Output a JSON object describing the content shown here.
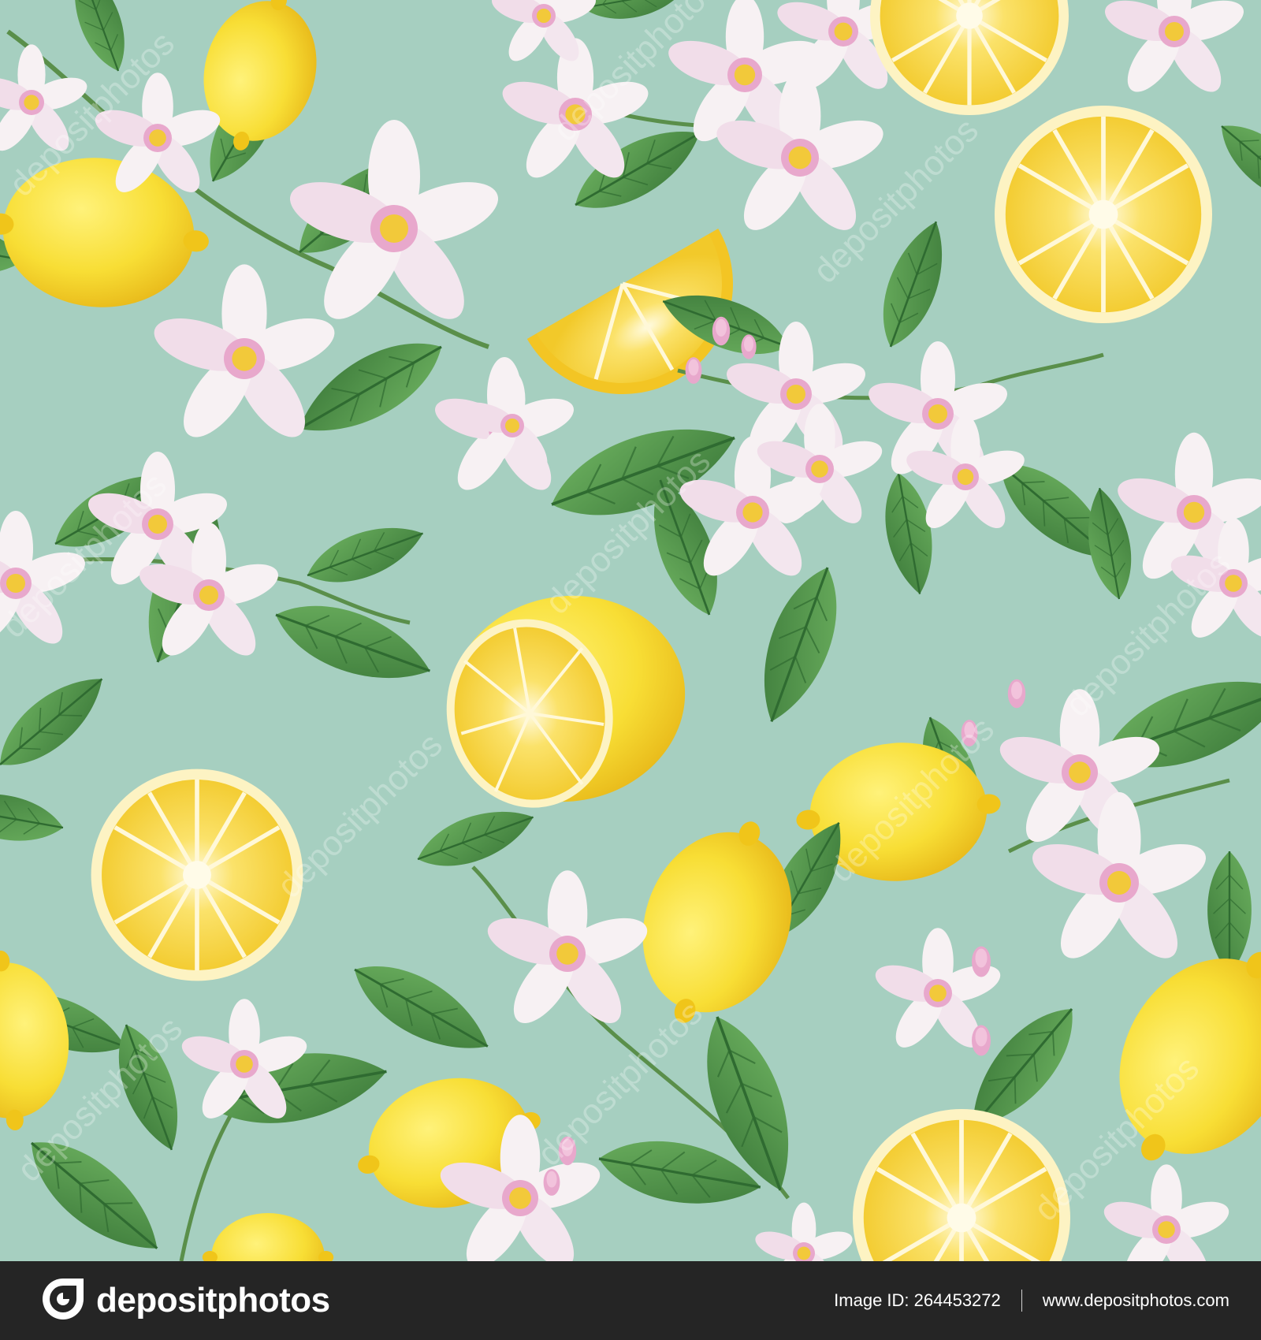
{
  "colors": {
    "background": "#a6cfc0",
    "lemon": "#f8de35",
    "lemon_shade": "#f0c51a",
    "orange": "#f2ad2c",
    "leaf": "#4f9a4c",
    "leaf_dark": "#3f7d3b",
    "petal": "#f7f1f3",
    "petal_pink": "#e8a8cc",
    "footer": "#252525"
  },
  "watermark": {
    "text": "depositphotos"
  },
  "footer": {
    "brand": "depositphotos",
    "image_id_label": "Image ID: 264453272",
    "site": "www.depositphotos.com"
  },
  "icons": {
    "logo": "depositphotos-logo-icon"
  }
}
